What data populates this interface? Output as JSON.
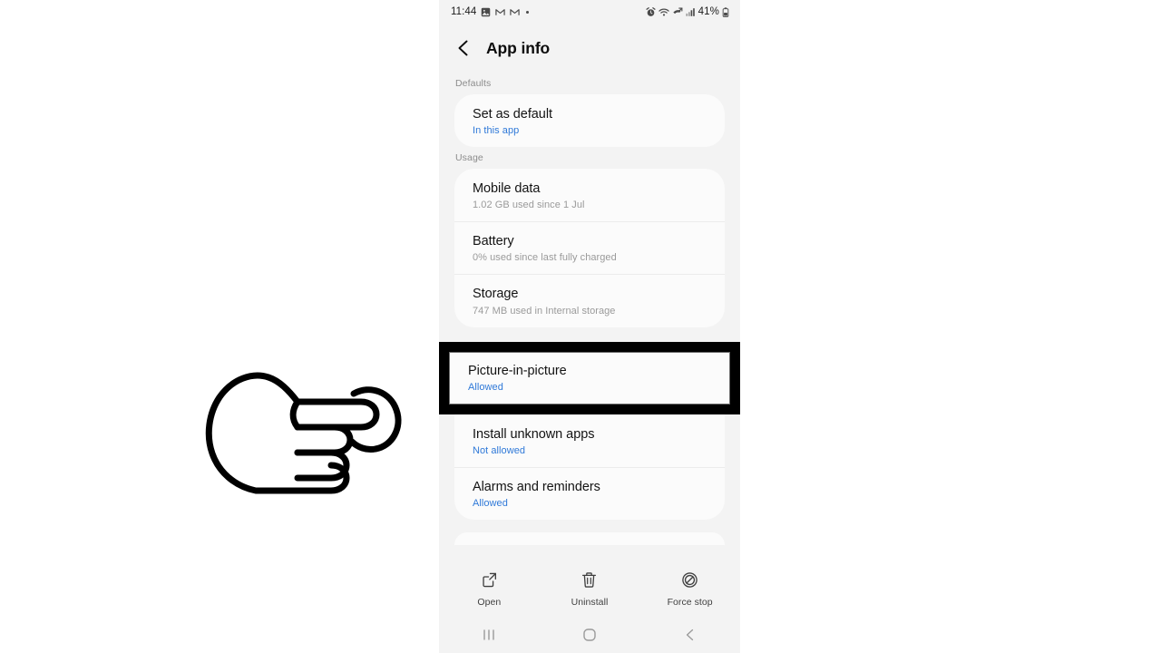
{
  "status_bar": {
    "time": "11:44",
    "left_icons": [
      "photos-icon",
      "gmail-icon",
      "gmail-icon",
      "dot-indicator"
    ],
    "right_icons": [
      "alarm-icon",
      "wifi-icon",
      "missed-call-icon",
      "signal-icon"
    ],
    "battery_percent": "41%",
    "battery_icon": "battery-icon"
  },
  "header": {
    "back_icon": "back-chevron-icon",
    "title": "App info"
  },
  "sections": [
    {
      "header": "Defaults",
      "rows": [
        {
          "title": "Set as default",
          "subtitle": "In this app",
          "subtitle_style": "link"
        }
      ]
    },
    {
      "header": "Usage",
      "rows": [
        {
          "title": "Mobile data",
          "subtitle": "1.02 GB used since 1 Jul",
          "subtitle_style": "muted"
        },
        {
          "title": "Battery",
          "subtitle": "0% used since last fully charged",
          "subtitle_style": "muted"
        },
        {
          "title": "Storage",
          "subtitle": "747 MB used in Internal storage",
          "subtitle_style": "muted"
        }
      ]
    }
  ],
  "permissions": {
    "highlighted_row": {
      "title": "Picture-in-picture",
      "subtitle": "Allowed",
      "subtitle_style": "link"
    },
    "rows": [
      {
        "title": "Install unknown apps",
        "subtitle": "Not allowed",
        "subtitle_style": "link"
      },
      {
        "title": "Alarms and reminders",
        "subtitle": "Allowed",
        "subtitle_style": "link"
      }
    ]
  },
  "action_bar": [
    {
      "icon": "open-external-icon",
      "label": "Open"
    },
    {
      "icon": "trash-icon",
      "label": "Uninstall"
    },
    {
      "icon": "force-stop-icon",
      "label": "Force stop"
    }
  ],
  "nav_bar": [
    {
      "icon": "recents-icon",
      "name": "recents-button"
    },
    {
      "icon": "home-icon",
      "name": "home-button"
    },
    {
      "icon": "back-icon",
      "name": "back-button"
    }
  ],
  "annotation": {
    "pointer_icon": "pointing-hand-icon",
    "highlight_color": "#000000"
  },
  "colors": {
    "link": "#2f79d8",
    "phone_bg": "#f3f3f3",
    "card_bg": "#fbfbfb",
    "page_bg": "#ffffff"
  }
}
